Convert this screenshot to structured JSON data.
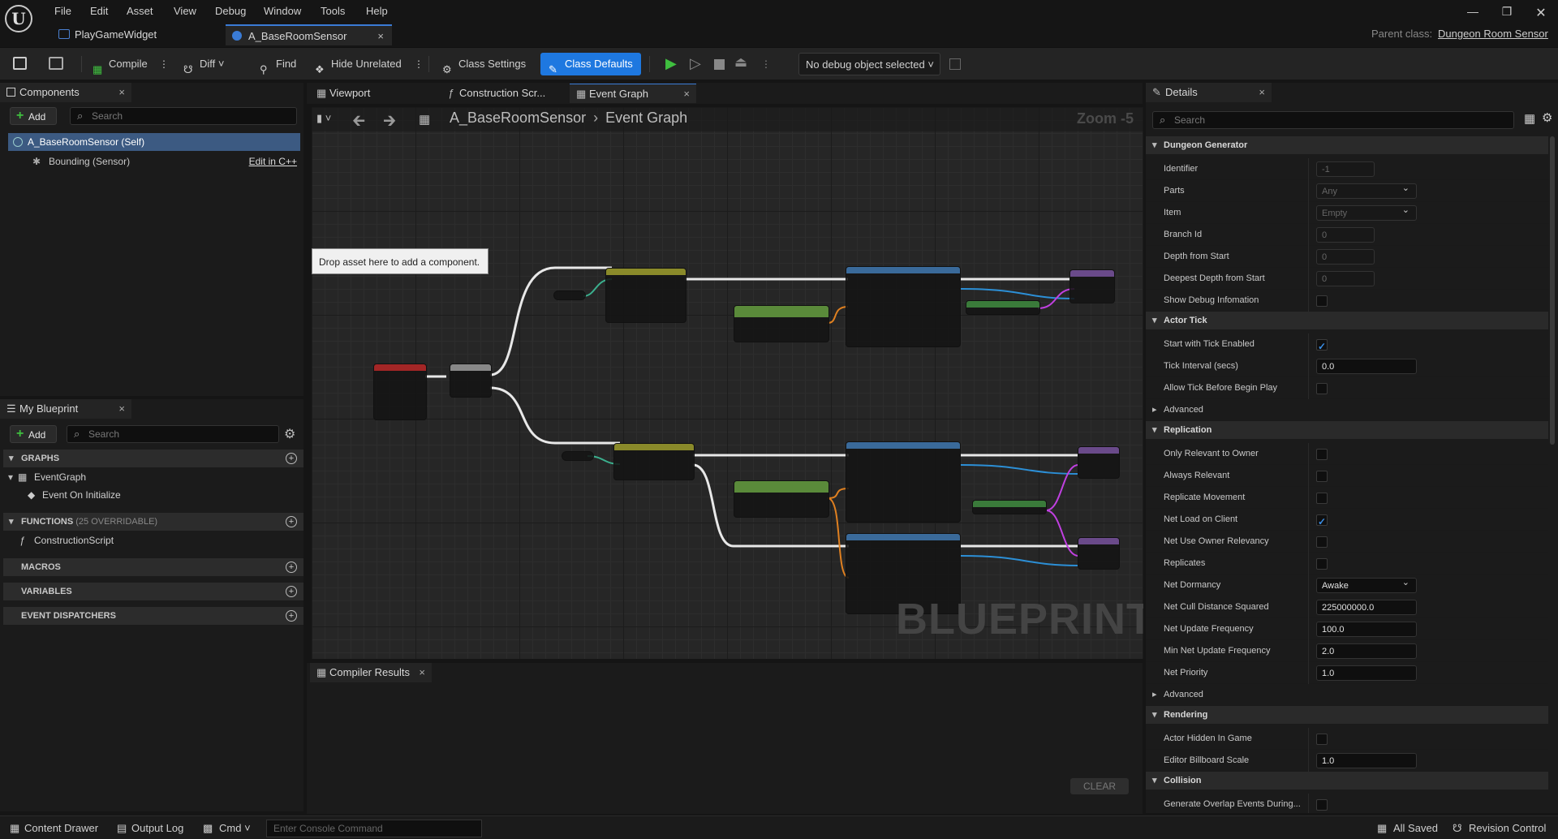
{
  "menu": [
    "File",
    "Edit",
    "Asset",
    "View",
    "Debug",
    "Window",
    "Tools",
    "Help"
  ],
  "doc_tabs": [
    {
      "label": "PlayGameWidget",
      "active": false
    },
    {
      "label": "A_BaseRoomSensor",
      "active": true
    }
  ],
  "parent_class": {
    "label": "Parent class:",
    "value": "Dungeon Room Sensor"
  },
  "toolbar": {
    "compile": "Compile",
    "diff": "Diff",
    "find": "Find",
    "hide_unrelated": "Hide Unrelated",
    "class_settings": "Class Settings",
    "class_defaults": "Class Defaults",
    "debug_object": "No debug object selected"
  },
  "components": {
    "tab": "Components",
    "add": "Add",
    "search_placeholder": "Search",
    "items": [
      {
        "label": "A_BaseRoomSensor (Self)"
      },
      {
        "label": "Bounding (Sensor)",
        "action": "Edit in C++"
      }
    ]
  },
  "my_blueprint": {
    "tab": "My Blueprint",
    "add": "Add",
    "search_placeholder": "Search",
    "graphs": "GRAPHS",
    "event_graph": "EventGraph",
    "event_on_init": "Event On Initialize",
    "functions": "FUNCTIONS",
    "functions_note": "(25 OVERRIDABLE)",
    "construction_script": "ConstructionScript",
    "macros": "MACROS",
    "variables": "VARIABLES",
    "event_dispatchers": "EVENT DISPATCHERS"
  },
  "graph_tabs": [
    "Viewport",
    "Construction Scr...",
    "Event Graph"
  ],
  "breadcrumb": {
    "asset": "A_BaseRoomSensor",
    "graph": "Event Graph"
  },
  "zoom": "Zoom -5",
  "drop_hint": "Drop asset here to add a component.",
  "watermark": "BLUEPRINT",
  "compiler": {
    "tab": "Compiler Results",
    "clear": "CLEAR"
  },
  "details": {
    "tab": "Details",
    "search_placeholder": "Search",
    "sections": [
      {
        "title": "Dungeon Generator",
        "rows": [
          {
            "label": "Identifier",
            "type": "text",
            "value": "-1",
            "disabled": true
          },
          {
            "label": "Parts",
            "type": "dropdown",
            "value": "Any",
            "disabled": true
          },
          {
            "label": "Item",
            "type": "dropdown",
            "value": "Empty",
            "disabled": true
          },
          {
            "label": "Branch Id",
            "type": "text",
            "value": "0",
            "disabled": true
          },
          {
            "label": "Depth from Start",
            "type": "text",
            "value": "0",
            "disabled": true
          },
          {
            "label": "Deepest Depth from Start",
            "type": "text",
            "value": "0",
            "disabled": true
          },
          {
            "label": "Show Debug Infomation",
            "type": "check",
            "checked": false
          }
        ]
      },
      {
        "title": "Actor Tick",
        "rows": [
          {
            "label": "Start with Tick Enabled",
            "type": "check",
            "checked": true
          },
          {
            "label": "Tick Interval (secs)",
            "type": "text",
            "value": "0.0"
          },
          {
            "label": "Allow Tick Before Begin Play",
            "type": "check",
            "checked": false
          },
          {
            "label": "Advanced",
            "type": "advanced"
          }
        ]
      },
      {
        "title": "Replication",
        "rows": [
          {
            "label": "Only Relevant to Owner",
            "type": "check",
            "checked": false
          },
          {
            "label": "Always Relevant",
            "type": "check",
            "checked": false
          },
          {
            "label": "Replicate Movement",
            "type": "check",
            "checked": false
          },
          {
            "label": "Net Load on Client",
            "type": "check",
            "checked": true
          },
          {
            "label": "Net Use Owner Relevancy",
            "type": "check",
            "checked": false
          },
          {
            "label": "Replicates",
            "type": "check",
            "checked": false
          },
          {
            "label": "Net Dormancy",
            "type": "dropdown",
            "value": "Awake"
          },
          {
            "label": "Net Cull Distance Squared",
            "type": "text",
            "value": "225000000.0"
          },
          {
            "label": "Net Update Frequency",
            "type": "text",
            "value": "100.0"
          },
          {
            "label": "Min Net Update Frequency",
            "type": "text",
            "value": "2.0"
          },
          {
            "label": "Net Priority",
            "type": "text",
            "value": "1.0"
          },
          {
            "label": "Advanced",
            "type": "advanced"
          }
        ]
      },
      {
        "title": "Rendering",
        "rows": [
          {
            "label": "Actor Hidden In Game",
            "type": "check",
            "checked": false
          },
          {
            "label": "Editor Billboard Scale",
            "type": "text",
            "value": "1.0"
          }
        ]
      },
      {
        "title": "Collision",
        "rows": [
          {
            "label": "Generate Overlap Events During...",
            "type": "check",
            "checked": false
          }
        ]
      }
    ]
  },
  "status": {
    "content_drawer": "Content Drawer",
    "output_log": "Output Log",
    "cmd": "Cmd",
    "console_placeholder": "Enter Console Command",
    "all_saved": "All Saved",
    "revision_control": "Revision Control"
  }
}
